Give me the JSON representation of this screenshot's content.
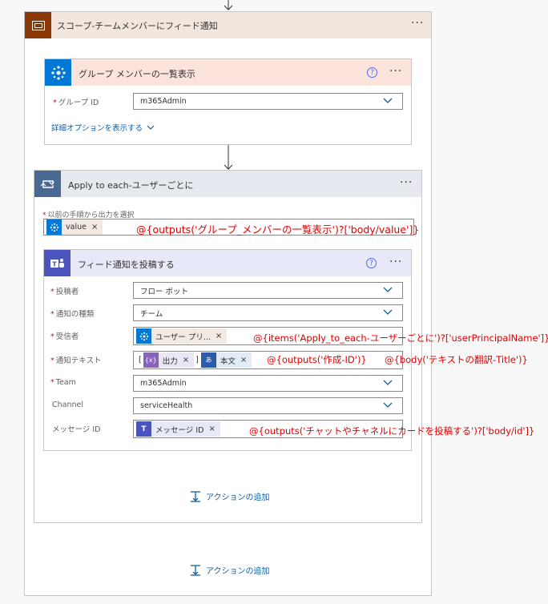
{
  "scope": {
    "title": "スコープ-チームメンバーにフィード通知",
    "menu": "···"
  },
  "list_members": {
    "title": "グループ メンバーの一覧表示",
    "help": "?",
    "menu": "···",
    "group_id_label": "グループ ID",
    "group_id_value": "m365Admin",
    "advanced_link": "詳細オプションを表示する"
  },
  "apply_each": {
    "title": "Apply to each-ユーザーごとに",
    "menu": "···",
    "select_label": "以前の手順から出力を選択",
    "token_value": "value",
    "token_x": "×"
  },
  "post_feed": {
    "title": "フィード通知を投稿する",
    "help": "?",
    "menu": "···",
    "fields": {
      "poster_label": "投稿者",
      "poster_value": "フロー ボット",
      "type_label": "通知の種類",
      "type_value": "チーム",
      "recipient_label": "受信者",
      "recipient_token": "ユーザー プリ...",
      "text_label": "通知テキスト",
      "text_bracket_open": "[",
      "text_token1": "出力",
      "text_bracket_close": "]",
      "text_token2": "本文",
      "team_label": "Team",
      "team_value": "m365Admin",
      "channel_label": "Channel",
      "channel_value": "serviceHealth",
      "message_label": "メッセージ ID",
      "message_token": "メッセージ ID"
    },
    "add_action": "アクションの追加"
  },
  "outer_add_action": "アクションの追加",
  "annotations": {
    "value_expr": "@{outputs('グループ_メンバーの一覧表示')?['body/value']}",
    "recipient_expr": "@{items('Apply_to_each-ユーザーごとに')?['userPrincipalName']}",
    "output_expr": "@{outputs('作成-ID')}",
    "body_expr": "@{body('テキストの翻訳-Title')}",
    "message_expr": "@{outputs('チャットやチャネルにカードを投稿する')?['body/id']}"
  },
  "colors": {
    "scope_icon": "#8a3707",
    "scope_header": "#f2e6df",
    "members_icon": "#0078d4",
    "members_header": "#fce4dc",
    "loop_icon": "#486991",
    "loop_header": "#e6eaf0",
    "teams_icon": "#4b53bc",
    "teams_header": "#e8e9f8",
    "annotation": "#e00000"
  }
}
